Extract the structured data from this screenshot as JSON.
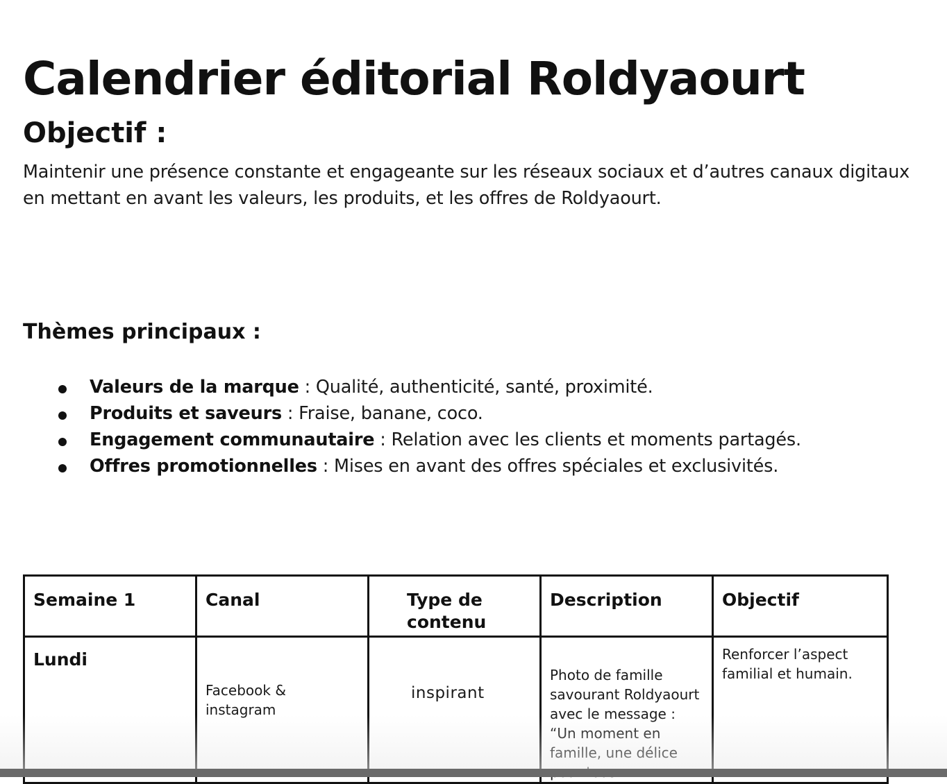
{
  "document": {
    "title": "Calendrier éditorial Roldyaourt",
    "objective_heading": "Objectif :",
    "objective_text": "Maintenir une présence constante et engageante sur les réseaux sociaux et d’autres canaux digitaux en mettant en avant les valeurs, les produits, et les offres de Roldyaourt.",
    "themes_heading": "Thèmes principaux :",
    "themes": [
      {
        "label": "Valeurs de la marque",
        "text": " : Qualité, authenticité, santé, proximité."
      },
      {
        "label": "Produits et saveurs",
        "text": " : Fraise, banane, coco."
      },
      {
        "label": "Engagement communautaire",
        "text": " : Relation avec les clients et moments partagés."
      },
      {
        "label": "Offres promotionnelles",
        "text": " : Mises en avant des offres spéciales et exclusivités."
      }
    ]
  },
  "table": {
    "headers": [
      "Semaine 1",
      "Canal",
      "Type de contenu",
      "Description",
      "Objectif"
    ],
    "rows": [
      {
        "day": "Lundi",
        "canal": "Facebook & instagram",
        "type": "inspirant",
        "description": "Photo de famille savourant Roldyaourt avec le message : “Un moment en famille, une délice pour tous.",
        "objectif": " Renforcer l’aspect familial et humain."
      }
    ]
  }
}
